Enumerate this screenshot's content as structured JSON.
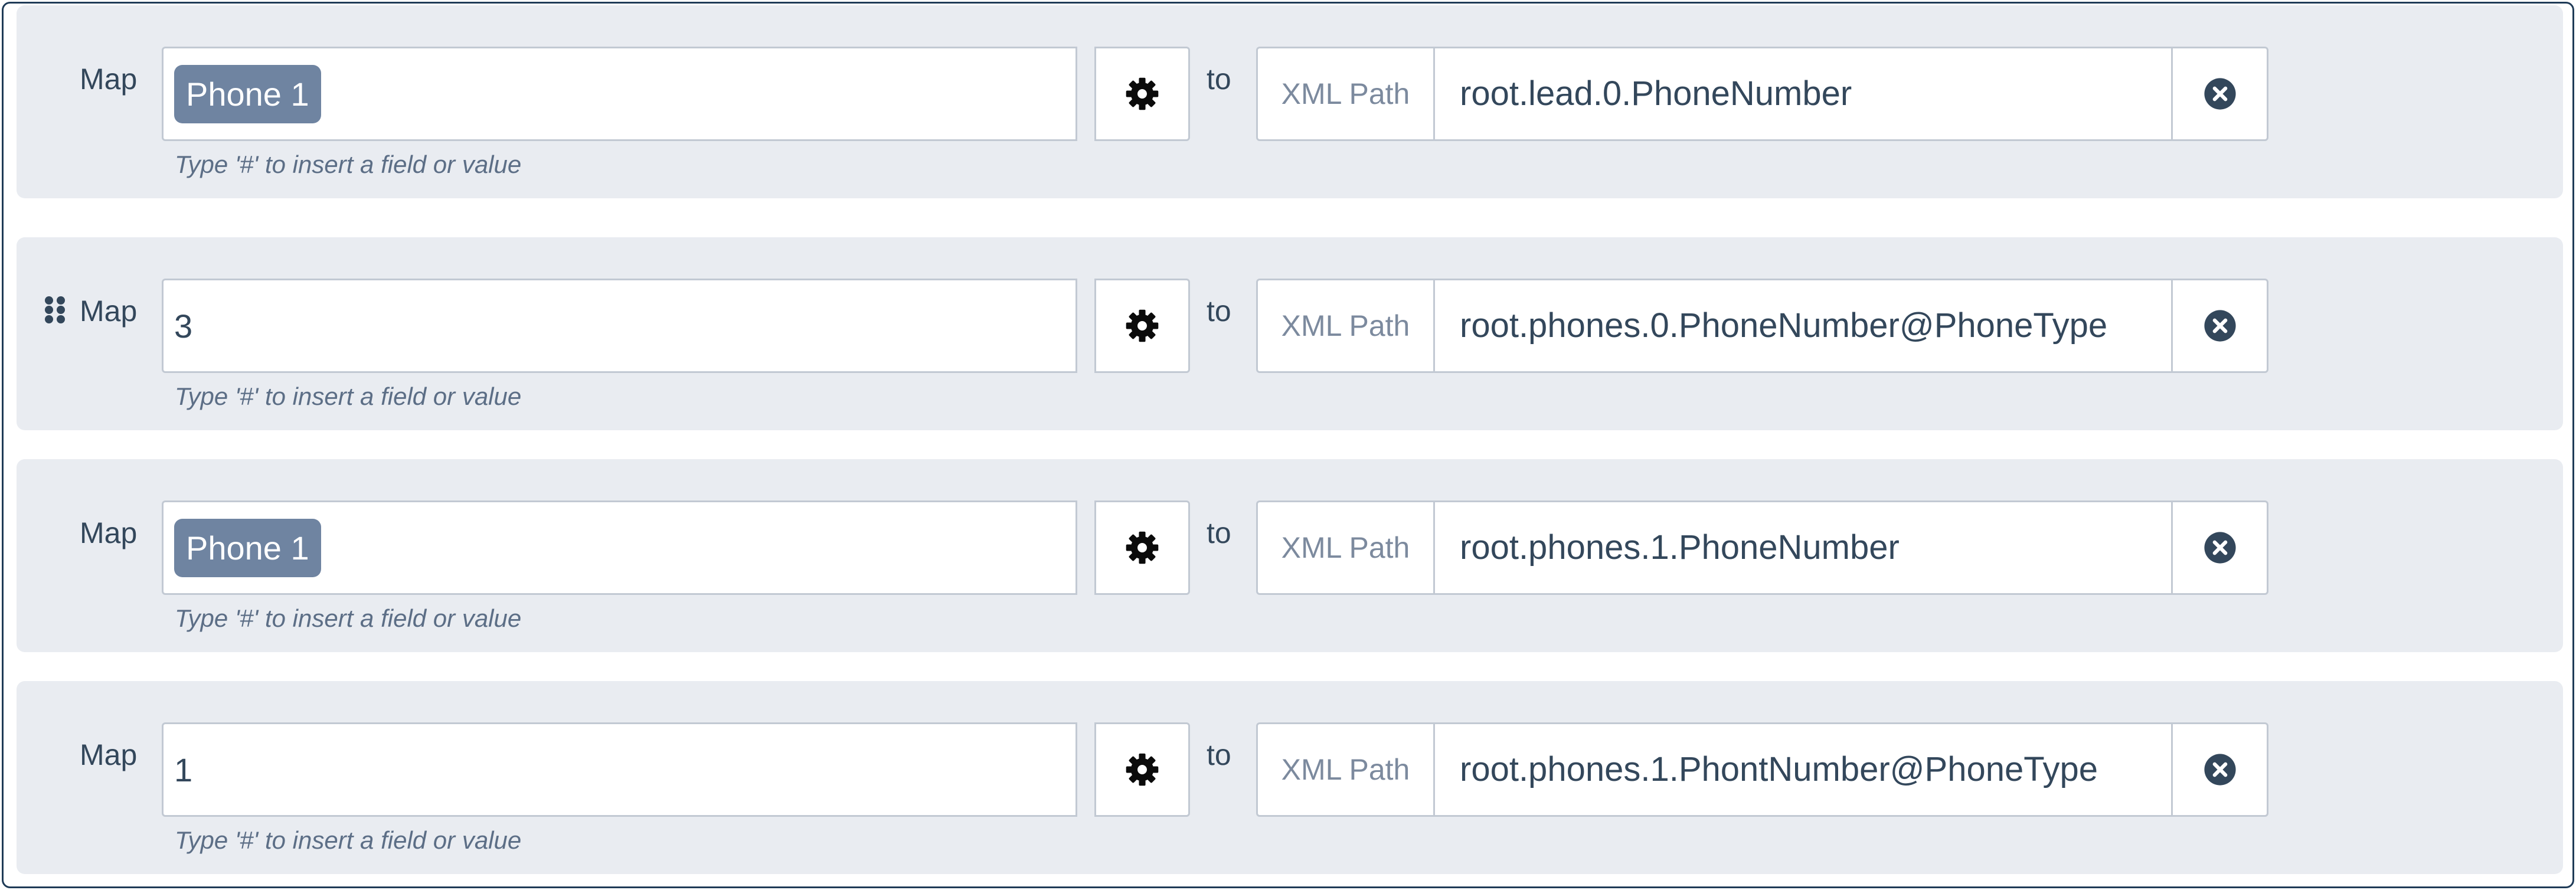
{
  "rows": [
    {
      "map_label": "Map",
      "value_kind": "chip",
      "value": "Phone 1",
      "hint": "Type '#' to insert a field or value",
      "to_label": "to",
      "path_prefix": "XML Path",
      "path_value": "root.lead.0.PhoneNumber",
      "show_drag_handle": false
    },
    {
      "map_label": "Map",
      "value_kind": "text",
      "value": "3",
      "hint": "Type '#' to insert a field or value",
      "to_label": "to",
      "path_prefix": "XML Path",
      "path_value": "root.phones.0.PhoneNumber@PhoneType",
      "show_drag_handle": true
    },
    {
      "map_label": "Map",
      "value_kind": "chip",
      "value": "Phone 1",
      "hint": "Type '#' to insert a field or value",
      "to_label": "to",
      "path_prefix": "XML Path",
      "path_value": "root.phones.1.PhoneNumber",
      "show_drag_handle": false
    },
    {
      "map_label": "Map",
      "value_kind": "text",
      "value": "1",
      "hint": "Type '#' to insert a field or value",
      "to_label": "to",
      "path_prefix": "XML Path",
      "path_value": "root.phones.1.PhontNumber@PhoneType",
      "show_drag_handle": false
    }
  ],
  "icons": {
    "settings": "gear-icon",
    "clear": "close-circle-icon",
    "drag": "drag-handle-icon"
  },
  "colors": {
    "row_background": "#e9ecf1",
    "chip_background": "#6f84a1",
    "text": "#33475b",
    "border": "#c2c9d3",
    "frame_border": "#1f3b57"
  }
}
